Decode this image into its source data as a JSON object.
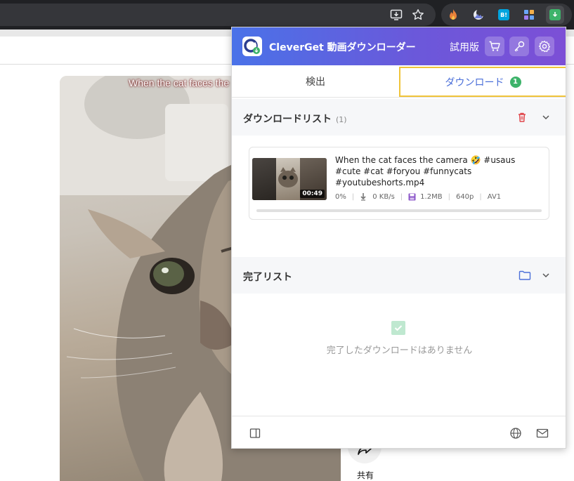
{
  "browser": {
    "icons": [
      "install-icon",
      "bookmark-star-icon",
      "fire-extension-icon",
      "moon-extension-icon",
      "hatena-extension-icon",
      "puzzle-extension-icon",
      "cleverget-extension-icon"
    ],
    "hatena_label": "B!"
  },
  "video": {
    "caption": "When the cat faces the",
    "share_label": "共有"
  },
  "panel": {
    "app_title": "CleverGet 動画ダウンローダー",
    "trial_label": "試用版",
    "header_buttons": [
      "cart-icon",
      "key-icon",
      "gear-icon"
    ],
    "tabs": {
      "detect": "検出",
      "download": "ダウンロード",
      "download_badge": "1"
    },
    "download_list": {
      "title": "ダウンロードリスト",
      "count": "(1)",
      "items": [
        {
          "filename": "When the cat faces the camera 🤣 #usaus #cute #cat #foryou #funnycats #youtubeshorts.mp4",
          "duration": "00:49",
          "progress": "0%",
          "progress_fraction": 0,
          "speed": "0 KB/s",
          "size": "1.2MB",
          "resolution": "640p",
          "codec": "AV1"
        }
      ]
    },
    "completed_list": {
      "title": "完了リスト",
      "empty_text": "完了したダウンロードはありません"
    },
    "footer_icons": [
      "sidebar-icon",
      "globe-icon",
      "mail-icon"
    ]
  },
  "colors": {
    "header_gradient_start": "#4a72e8",
    "header_gradient_end": "#7c4fd6",
    "accent": "#4b6fd9",
    "badge": "#3db36a",
    "active_tab_outline": "#f0c43a",
    "delete": "#e0454a"
  }
}
